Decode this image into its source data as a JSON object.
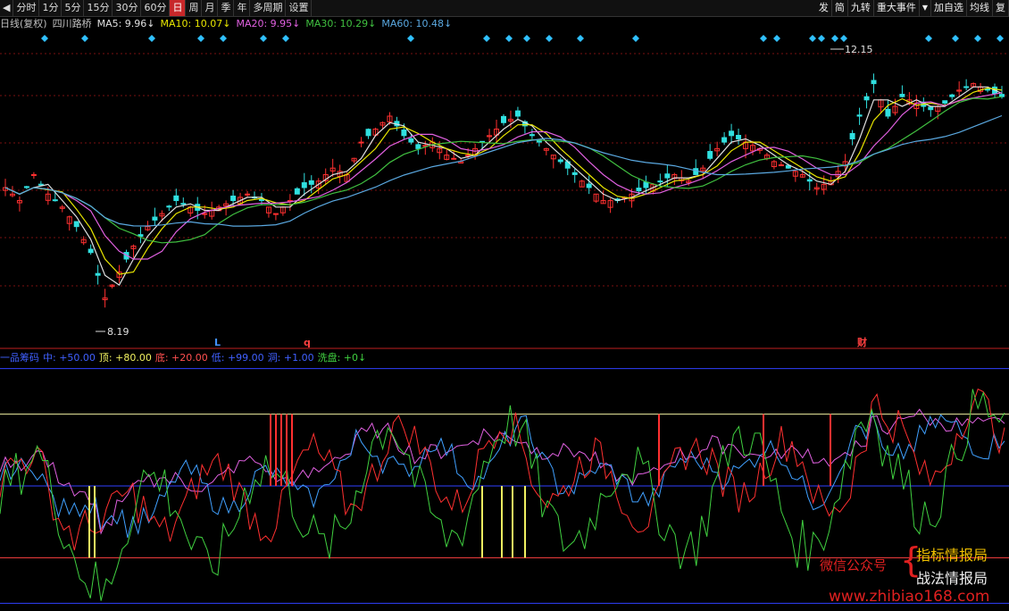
{
  "toolbar": {
    "back_icon": "back-arrow-icon",
    "periods": [
      "分时",
      "1分",
      "5分",
      "15分",
      "30分",
      "60分",
      "日",
      "周",
      "月",
      "季",
      "年",
      "多周期",
      "设置"
    ],
    "active_index": 6,
    "right_items": [
      "发",
      "简",
      "九转",
      "重大事件",
      "加自选",
      "均线",
      "复"
    ],
    "dropdown_icon": "dropdown-triangle-icon"
  },
  "main": {
    "chart_label": "日线(复权)",
    "stock_name": "四川路桥",
    "ma": [
      {
        "label": "MA5: 9.96↓",
        "color": "#e0e0e0"
      },
      {
        "label": "MA10: 10.07↓",
        "color": "#e8e600"
      },
      {
        "label": "MA20: 9.95↓",
        "color": "#e060e0"
      },
      {
        "label": "MA30: 10.29↓",
        "color": "#40c040"
      },
      {
        "label": "MA60: 10.48↓",
        "color": "#5aa8e0"
      }
    ],
    "high_label": "12.15",
    "low_label": "8.19",
    "markers": [
      "L",
      "q",
      "财"
    ]
  },
  "sub": {
    "name": "一品筹码",
    "items": [
      {
        "label": "中: +50.00",
        "color": "#4060ff"
      },
      {
        "label": "顶: +80.00",
        "color": "#f0f060"
      },
      {
        "label": "底: +20.00",
        "color": "#ff5050"
      },
      {
        "label": "低: +99.00",
        "color": "#4060ff"
      },
      {
        "label": "洞: +1.00",
        "color": "#4060ff"
      },
      {
        "label": "洗盘: +0↓",
        "color": "#40d040"
      }
    ]
  },
  "watermark": {
    "prefix": "微信公众号",
    "line1": "指标情报局",
    "line2": "战法情报局",
    "site": "www.zhibiao168.com"
  },
  "colors": {
    "up": "#ff3030",
    "down": "#30e0e0",
    "grid": "#7a1010",
    "axis": "#c02020"
  },
  "chart_data": {
    "type": "candlestick",
    "price_range": [
      8.19,
      12.15
    ],
    "annotated_high": 12.15,
    "annotated_low": 8.19,
    "close_series": [
      10.2,
      10.0,
      10.4,
      10.1,
      9.9,
      9.6,
      9.2,
      8.5,
      8.9,
      9.3,
      9.6,
      9.8,
      10.0,
      9.9,
      9.8,
      9.9,
      10.0,
      10.1,
      10.0,
      9.8,
      10.0,
      10.2,
      10.3,
      10.5,
      10.4,
      10.9,
      11.1,
      11.3,
      11.0,
      10.8,
      10.9,
      10.7,
      10.6,
      10.8,
      11.0,
      11.2,
      11.3,
      11.0,
      10.8,
      10.6,
      10.4,
      10.2,
      10.0,
      10.0,
      10.1,
      10.2,
      10.3,
      10.4,
      10.3,
      10.5,
      10.8,
      11.0,
      10.9,
      10.8,
      10.6,
      10.5,
      10.4,
      10.2,
      10.3,
      10.6,
      11.3,
      11.8,
      11.3,
      11.6,
      11.5,
      11.4,
      11.5,
      11.7,
      11.8,
      11.7,
      11.6
    ],
    "sub_levels": [
      99,
      80,
      50,
      20,
      1
    ]
  }
}
